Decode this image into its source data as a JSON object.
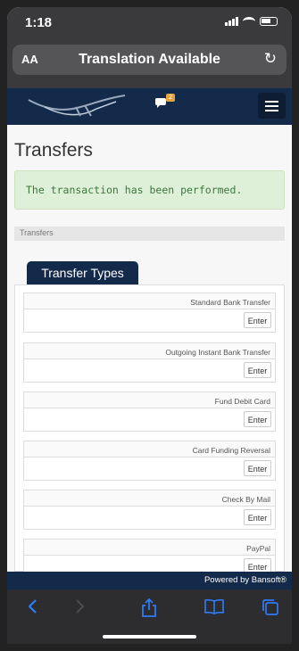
{
  "status_bar": {
    "time": "1:18"
  },
  "browser": {
    "aa_label": "AA",
    "translation_label": "Translation Available",
    "reload_icon": "↻"
  },
  "site": {
    "chat_badge": "2",
    "menu_icon": "hamburger-icon"
  },
  "page": {
    "title": "Transfers",
    "alert": "The transaction has been performed.",
    "breadcrumb": "Transfers",
    "tab_label": "Transfer Types"
  },
  "transfer_types": [
    {
      "label": "Standard Bank Transfer",
      "button": "Enter"
    },
    {
      "label": "Outgoing Instant Bank Transfer",
      "button": "Enter"
    },
    {
      "label": "Fund Debit Card",
      "button": "Enter"
    },
    {
      "label": "Card Funding Reversal",
      "button": "Enter"
    },
    {
      "label": "Check By Mail",
      "button": "Enter"
    },
    {
      "label": "PayPal",
      "button": "Enter"
    }
  ],
  "footer": {
    "powered_by": "Powered by Bansoft®"
  },
  "colors": {
    "navy": "#132a4a",
    "alert_bg": "#dff0d8",
    "alert_text": "#3c763d",
    "safari_blue": "#2f7bf6"
  }
}
